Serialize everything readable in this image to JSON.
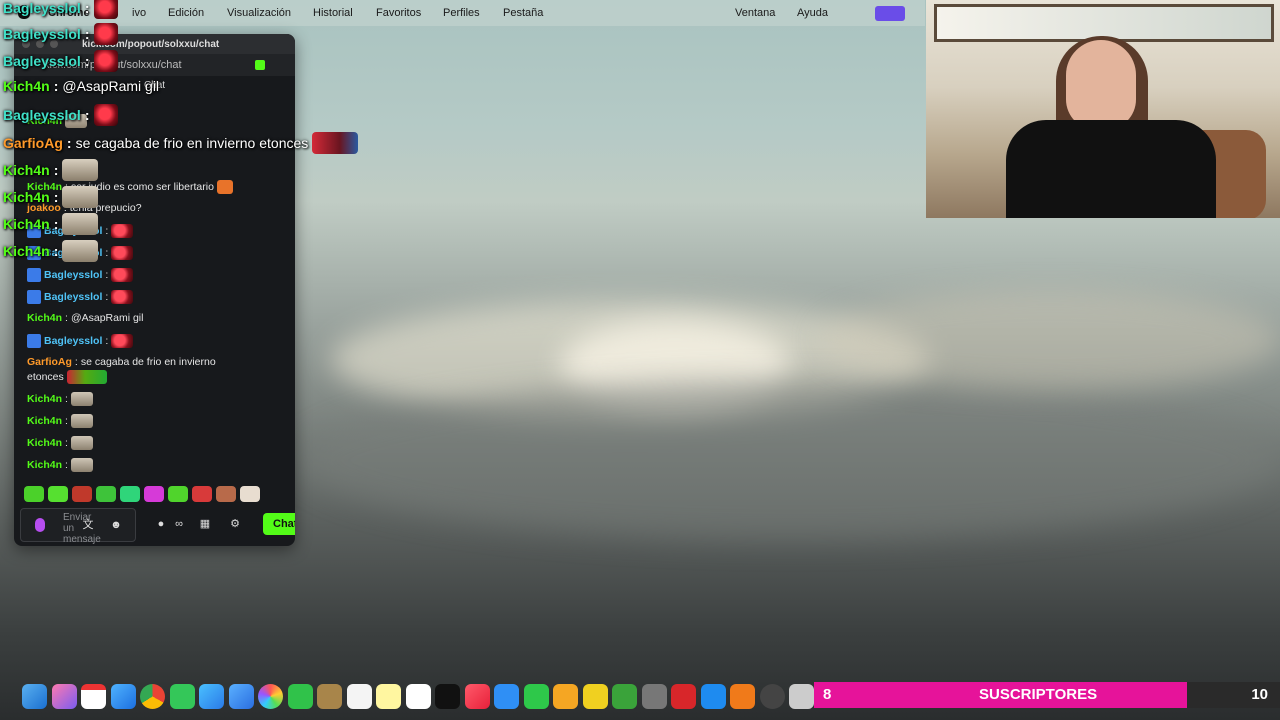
{
  "menubar": {
    "app": "Chrome",
    "items": [
      "ivo",
      "Edición",
      "Visualización",
      "Historial",
      "Favoritos",
      "Perfiles",
      "Pestaña",
      "Ventana",
      "Ayuda"
    ]
  },
  "browser": {
    "title": "kick.com/popout/solxxu/chat",
    "url": "kick.com/popout/solxxu/chat",
    "chat_header": "Chat"
  },
  "chat": {
    "messages": [
      {
        "user": "Kich4n",
        "text": ""
      },
      {
        "user": "Kich4n",
        "text": "ser judio es como ser libertario"
      },
      {
        "user": "joakoo",
        "text": "tenia prepucio?"
      },
      {
        "user": "Bagleysslol",
        "text": ""
      },
      {
        "user": "Bagleysslol",
        "text": ""
      },
      {
        "user": "Bagleysslol",
        "text": ""
      },
      {
        "user": "Bagleysslol",
        "text": ""
      },
      {
        "user": "Kich4n",
        "text": "@AsapRami gil"
      },
      {
        "user": "Bagleysslol",
        "text": ""
      },
      {
        "user": "GarfioAg",
        "text": "se cagaba de frio en invierno"
      },
      {
        "user": "",
        "text": "etonces"
      },
      {
        "user": "Kich4n",
        "text": ""
      },
      {
        "user": "Kich4n",
        "text": ""
      },
      {
        "user": "Kich4n",
        "text": ""
      },
      {
        "user": "Kich4n",
        "text": ""
      }
    ],
    "input_placeholder": "Enviar un mensaje",
    "send_label": "Chat"
  },
  "overlay": [
    {
      "user": "Bagleysslol",
      "text": ""
    },
    {
      "user": "Bagleysslol",
      "text": ""
    },
    {
      "user": "Bagleysslol",
      "text": ""
    },
    {
      "user": "Kich4n",
      "text": "@AsapRami gil"
    },
    {
      "user": "Bagleysslol",
      "text": ""
    },
    {
      "user": "GarfioAg",
      "text": "se cagaba de frio en invierno etonces"
    },
    {
      "user": "Kich4n",
      "text": ""
    },
    {
      "user": "Kich4n",
      "text": ""
    },
    {
      "user": "Kich4n",
      "text": ""
    },
    {
      "user": "Kich4n",
      "text": ""
    }
  ],
  "subs": {
    "current": "8",
    "label": "SUSCRIPTORES",
    "goal": "10",
    "progress": 0.8
  },
  "colors": {
    "kick_green": "#53fc18",
    "sub_pink": "#e6139a",
    "accent_purple": "#6a4de8"
  }
}
